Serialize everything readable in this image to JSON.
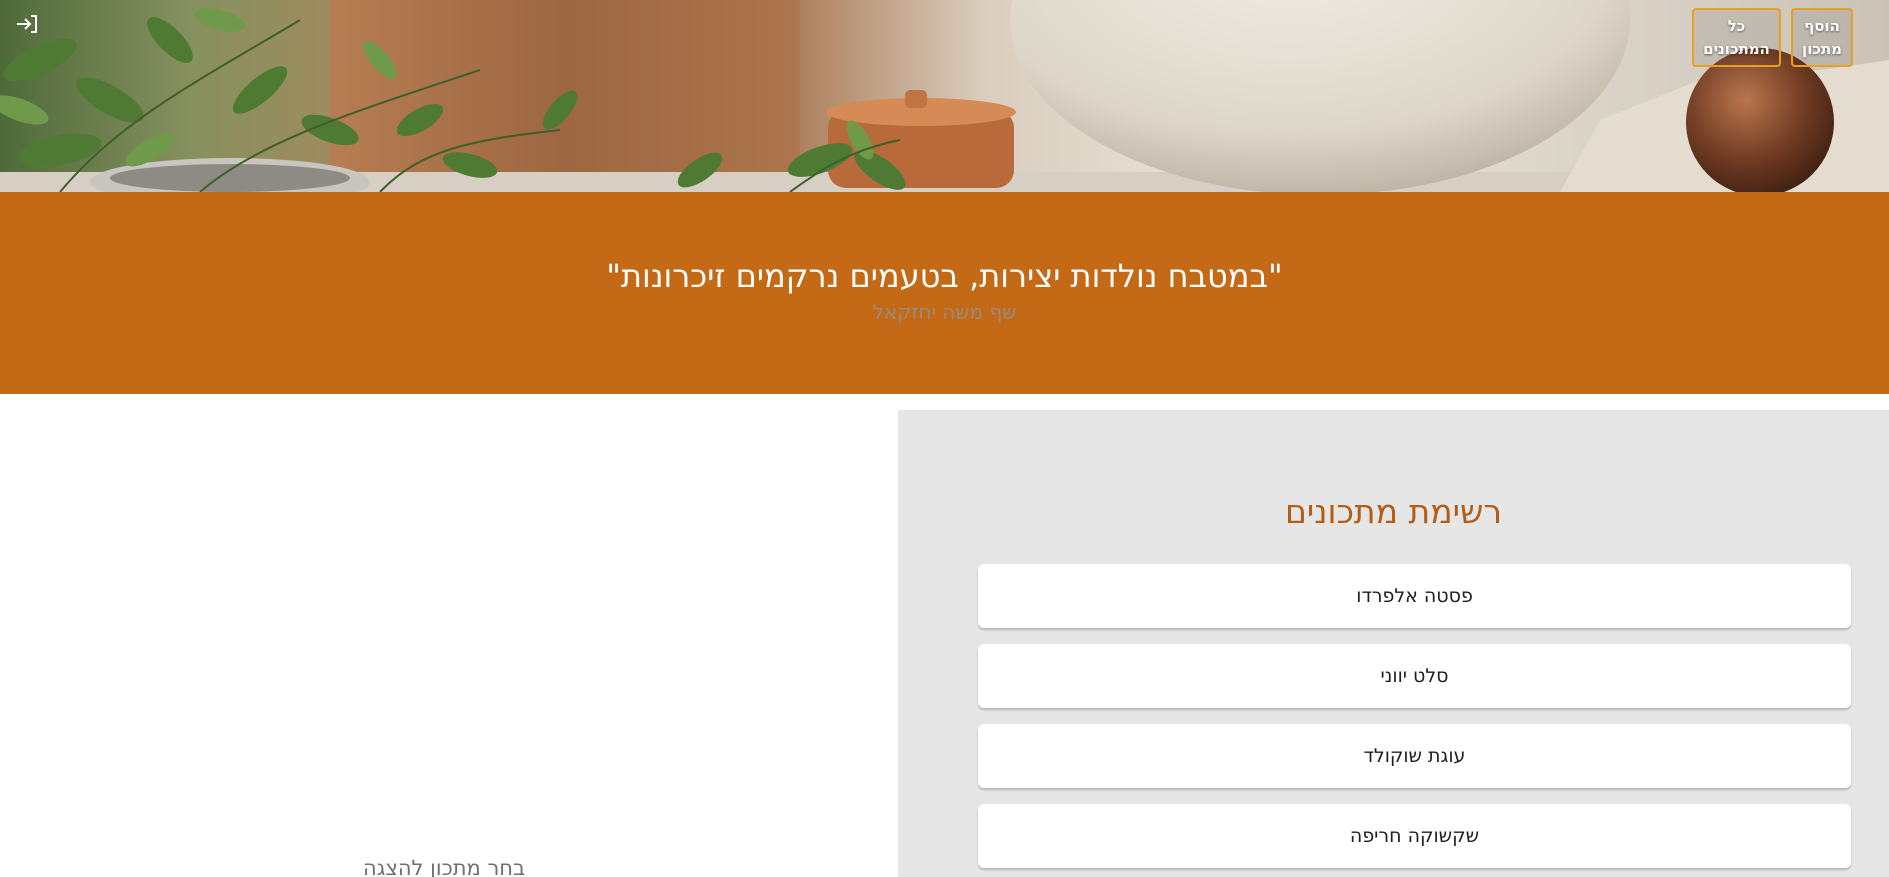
{
  "header": {
    "login_icon": "login-icon",
    "add_recipe_label": "הוסף מתכון",
    "all_recipes_label": "כל המתכונים"
  },
  "banner": {
    "quote": "\"במטבח נולדות יצירות, בטעמים נרקמים זיכרונות\"",
    "chef": "שף משה יחזקאל"
  },
  "recipes": {
    "title": "רשימת מתכונים",
    "items": [
      {
        "label": "פסטה אלפרדו"
      },
      {
        "label": "סלט יווני"
      },
      {
        "label": "עוגת שוקולד"
      },
      {
        "label": "שקשוקה חריפה"
      }
    ]
  },
  "detail": {
    "placeholder": "בחר מתכון להצגה"
  },
  "colors": {
    "banner": "#c46a16",
    "accent_border": "#e8a021",
    "panel_background": "#e6e6e6",
    "panel_title": "#b35d17"
  }
}
